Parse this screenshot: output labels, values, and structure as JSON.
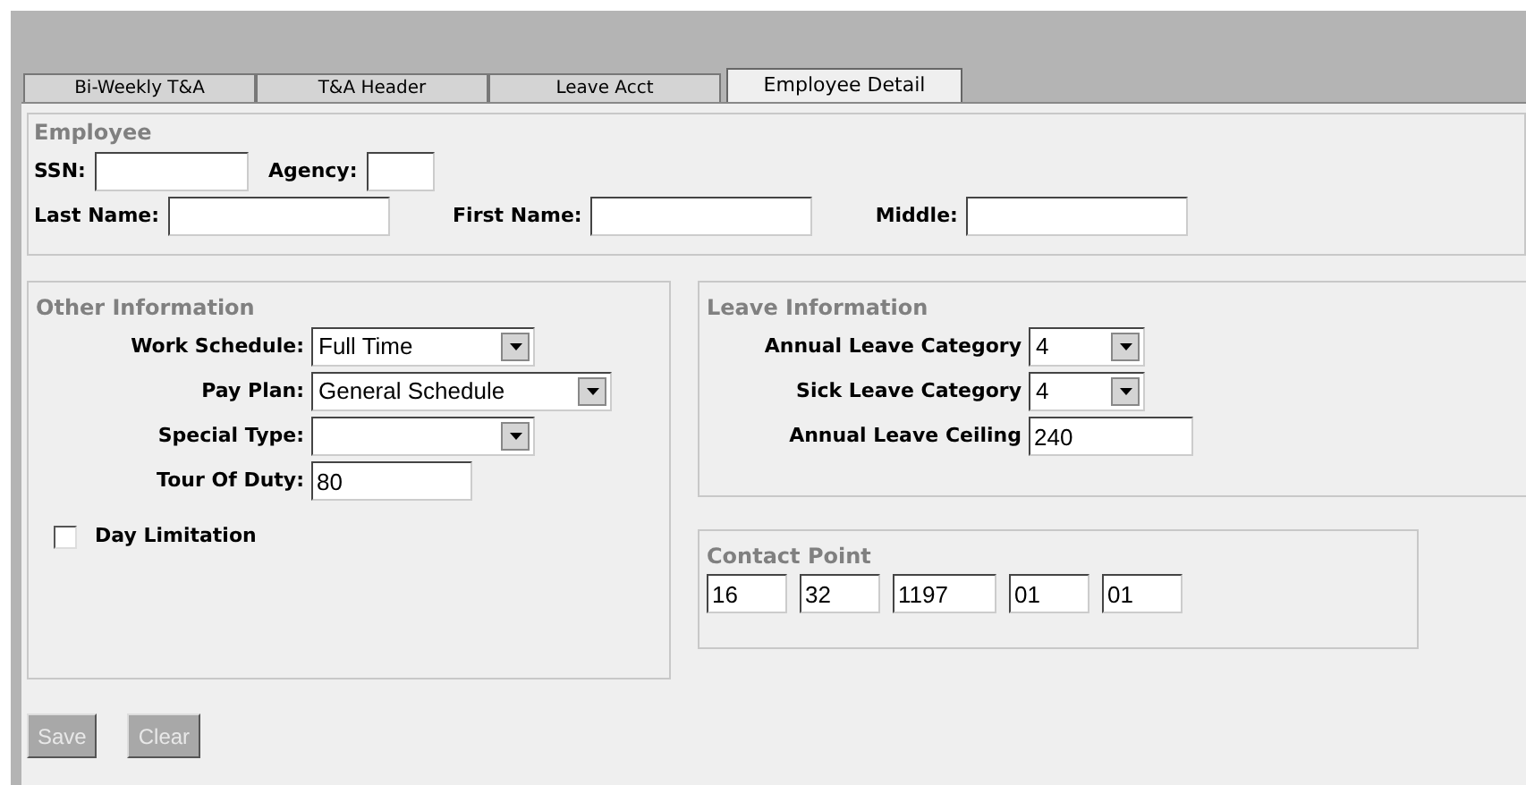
{
  "tabs": [
    {
      "label": "Bi-Weekly T&A",
      "selected": false
    },
    {
      "label": "T&A Header",
      "selected": false
    },
    {
      "label": "Leave Acct",
      "selected": false
    },
    {
      "label": "Employee Detail",
      "selected": true
    }
  ],
  "employee": {
    "title": "Employee",
    "rows": [
      [
        {
          "label": "SSN:",
          "kind": "input"
        },
        {
          "label": "Agency:",
          "kind": "input"
        }
      ],
      [
        {
          "label": "Last Name:",
          "kind": "input"
        },
        {
          "label": "First Name:",
          "kind": "input"
        },
        {
          "label": "Middle:",
          "kind": "input"
        }
      ]
    ]
  },
  "other_information": {
    "title": "Other Information",
    "fields": [
      {
        "label": "Work Schedule:",
        "kind": "select",
        "value": "Full Time"
      },
      {
        "label": "Pay Plan:",
        "kind": "select",
        "value": "General Schedule"
      },
      {
        "label": "Special Type:",
        "kind": "select"
      },
      {
        "label": "Tour Of Duty:",
        "kind": "input",
        "value": "80"
      }
    ],
    "checkbox": {
      "label": "Day Limitation",
      "checked": false
    }
  },
  "leave_information": {
    "title": "Leave Information",
    "fields": [
      {
        "label": "Annual Leave Category",
        "kind": "select",
        "value": "4"
      },
      {
        "label": "Sick Leave Category",
        "kind": "select",
        "value": "4"
      },
      {
        "label": "Annual Leave Ceiling",
        "kind": "input",
        "value": "240"
      }
    ]
  },
  "contact_point": {
    "title": "Contact Point",
    "values": [
      "16",
      "32",
      "1197",
      "01",
      "01"
    ]
  },
  "buttons": [
    {
      "label": "Save",
      "disabled": true
    },
    {
      "label": "Clear",
      "disabled": true
    }
  ]
}
